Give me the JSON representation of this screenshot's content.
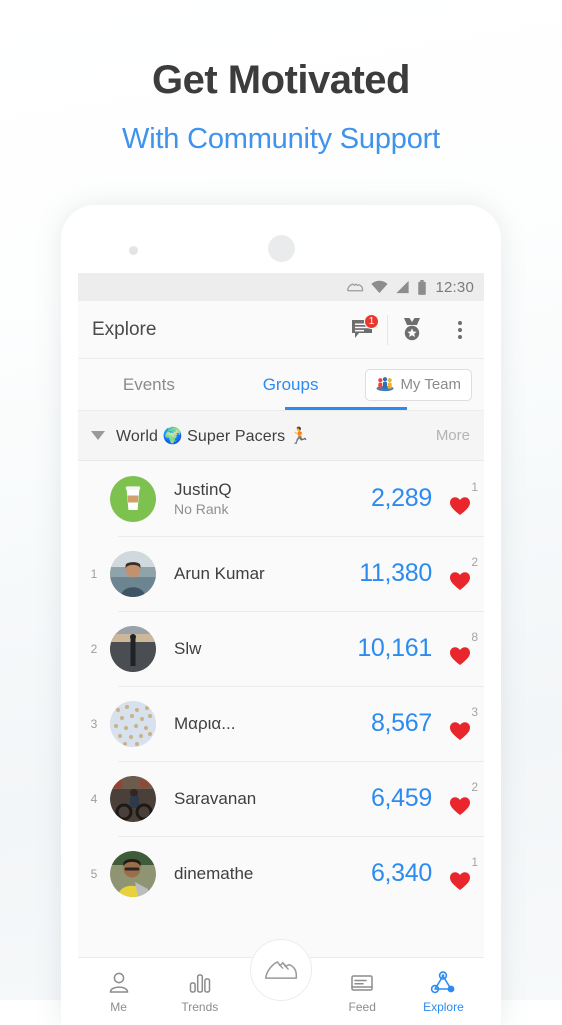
{
  "promo": {
    "title": "Get Motivated",
    "subtitle": "With Community Support",
    "title_color": "#3c3c3c",
    "subtitle_color": "#3f93ec"
  },
  "statusbar": {
    "time": "12:30",
    "icons": [
      "shoe-icon",
      "wifi-icon",
      "signal-icon",
      "battery-icon"
    ]
  },
  "appbar": {
    "title": "Explore",
    "chat_badge": "1",
    "actions": [
      "chat-icon",
      "medal-icon",
      "overflow-menu-icon"
    ]
  },
  "tabs": {
    "items": [
      {
        "label": "Events",
        "active": false
      },
      {
        "label": "Groups",
        "active": true
      }
    ],
    "my_team_label": "My Team",
    "accent_color": "#2d8bf0"
  },
  "section": {
    "title": "World 🌍 Super Pacers 🏃",
    "more_label": "More"
  },
  "leaderboard": {
    "rows": [
      {
        "rank": "",
        "name": "JustinQ",
        "sub": "No Rank",
        "steps": "2,289",
        "hearts": "1",
        "avatar": "coffee-cup"
      },
      {
        "rank": "1",
        "name": "Arun Kumar",
        "sub": "",
        "steps": "11,380",
        "hearts": "2",
        "avatar": "photo-man-lake"
      },
      {
        "rank": "2",
        "name": "Slw",
        "sub": "",
        "steps": "10,161",
        "hearts": "8",
        "avatar": "photo-silhouette"
      },
      {
        "rank": "3",
        "name": "Μαρια...",
        "sub": "",
        "steps": "8,567",
        "hearts": "3",
        "avatar": "photo-crowd"
      },
      {
        "rank": "4",
        "name": "Saravanan",
        "sub": "",
        "steps": "6,459",
        "hearts": "2",
        "avatar": "photo-motorbike"
      },
      {
        "rank": "5",
        "name": "dinemathe",
        "sub": "",
        "steps": "6,340",
        "hearts": "1",
        "avatar": "photo-man-yellow"
      }
    ],
    "steps_color": "#2d8bf0",
    "heart_color": "#e8262c"
  },
  "bottomnav": {
    "items": [
      {
        "label": "Me",
        "icon": "person-icon",
        "active": false
      },
      {
        "label": "Trends",
        "icon": "bars-icon",
        "active": false
      },
      {
        "label": "Feed",
        "icon": "feed-icon",
        "active": false
      },
      {
        "label": "Explore",
        "icon": "explore-icon",
        "active": true
      }
    ],
    "fab_icon": "shoe-icon"
  }
}
